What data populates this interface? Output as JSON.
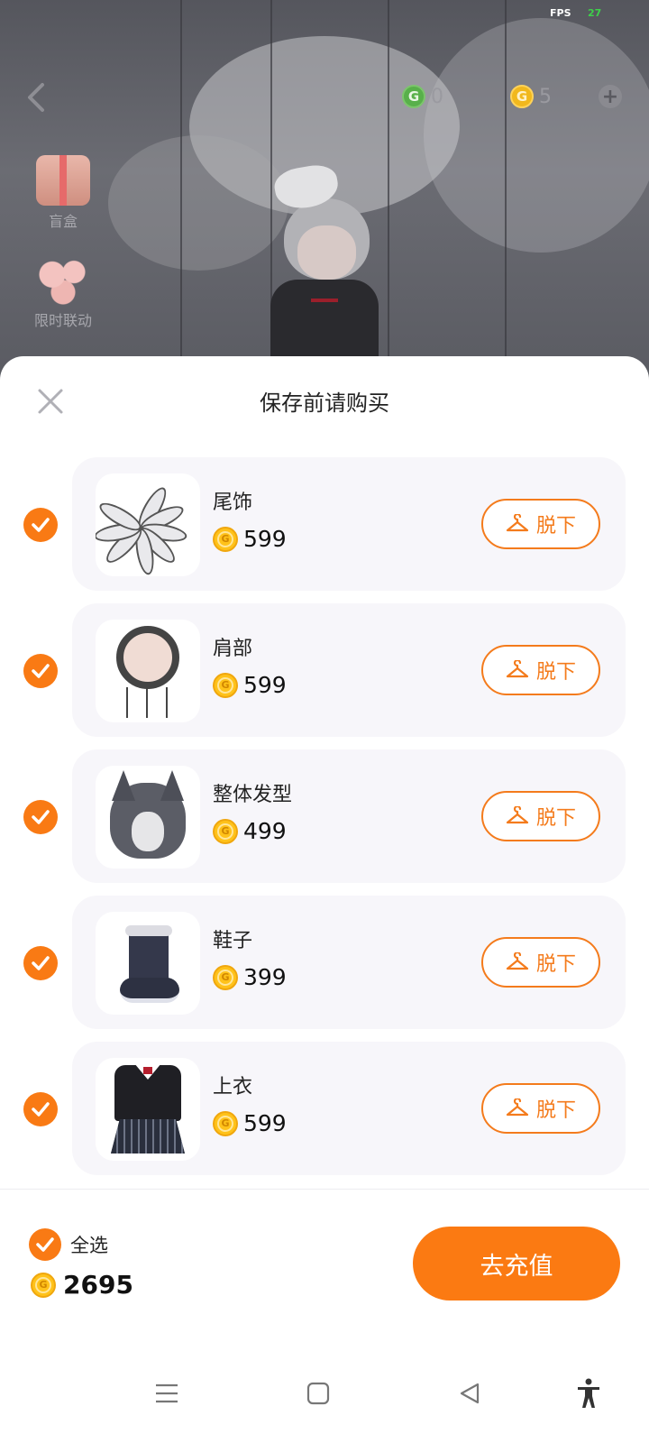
{
  "status": {
    "fps_label": "FPS",
    "fps_value": "27"
  },
  "header": {
    "green_coin_count": "0",
    "gold_coin_count": "5"
  },
  "side_menu": {
    "blind_box_label": "盲盒",
    "limited_label": "限时联动"
  },
  "sheet": {
    "title": "保存前请购买",
    "remove_label": "脱下",
    "items": [
      {
        "name": "尾饰",
        "price": "599",
        "checked": true
      },
      {
        "name": "肩部",
        "price": "599",
        "checked": true
      },
      {
        "name": "整体发型",
        "price": "499",
        "checked": true
      },
      {
        "name": "鞋子",
        "price": "399",
        "checked": true
      },
      {
        "name": "上衣",
        "price": "599",
        "checked": true
      }
    ]
  },
  "footer": {
    "select_all_label": "全选",
    "total": "2695",
    "recharge_label": "去充值"
  },
  "colors": {
    "accent": "#f97a14",
    "coin": "#ffc21a"
  },
  "icons": {
    "back": "chevron-left-icon",
    "close": "close-icon",
    "check": "check-icon",
    "hanger": "hanger-icon",
    "coin": "coin-icon",
    "nav": [
      "menu-icon",
      "home-icon",
      "back-triangle-icon",
      "accessibility-icon"
    ]
  }
}
